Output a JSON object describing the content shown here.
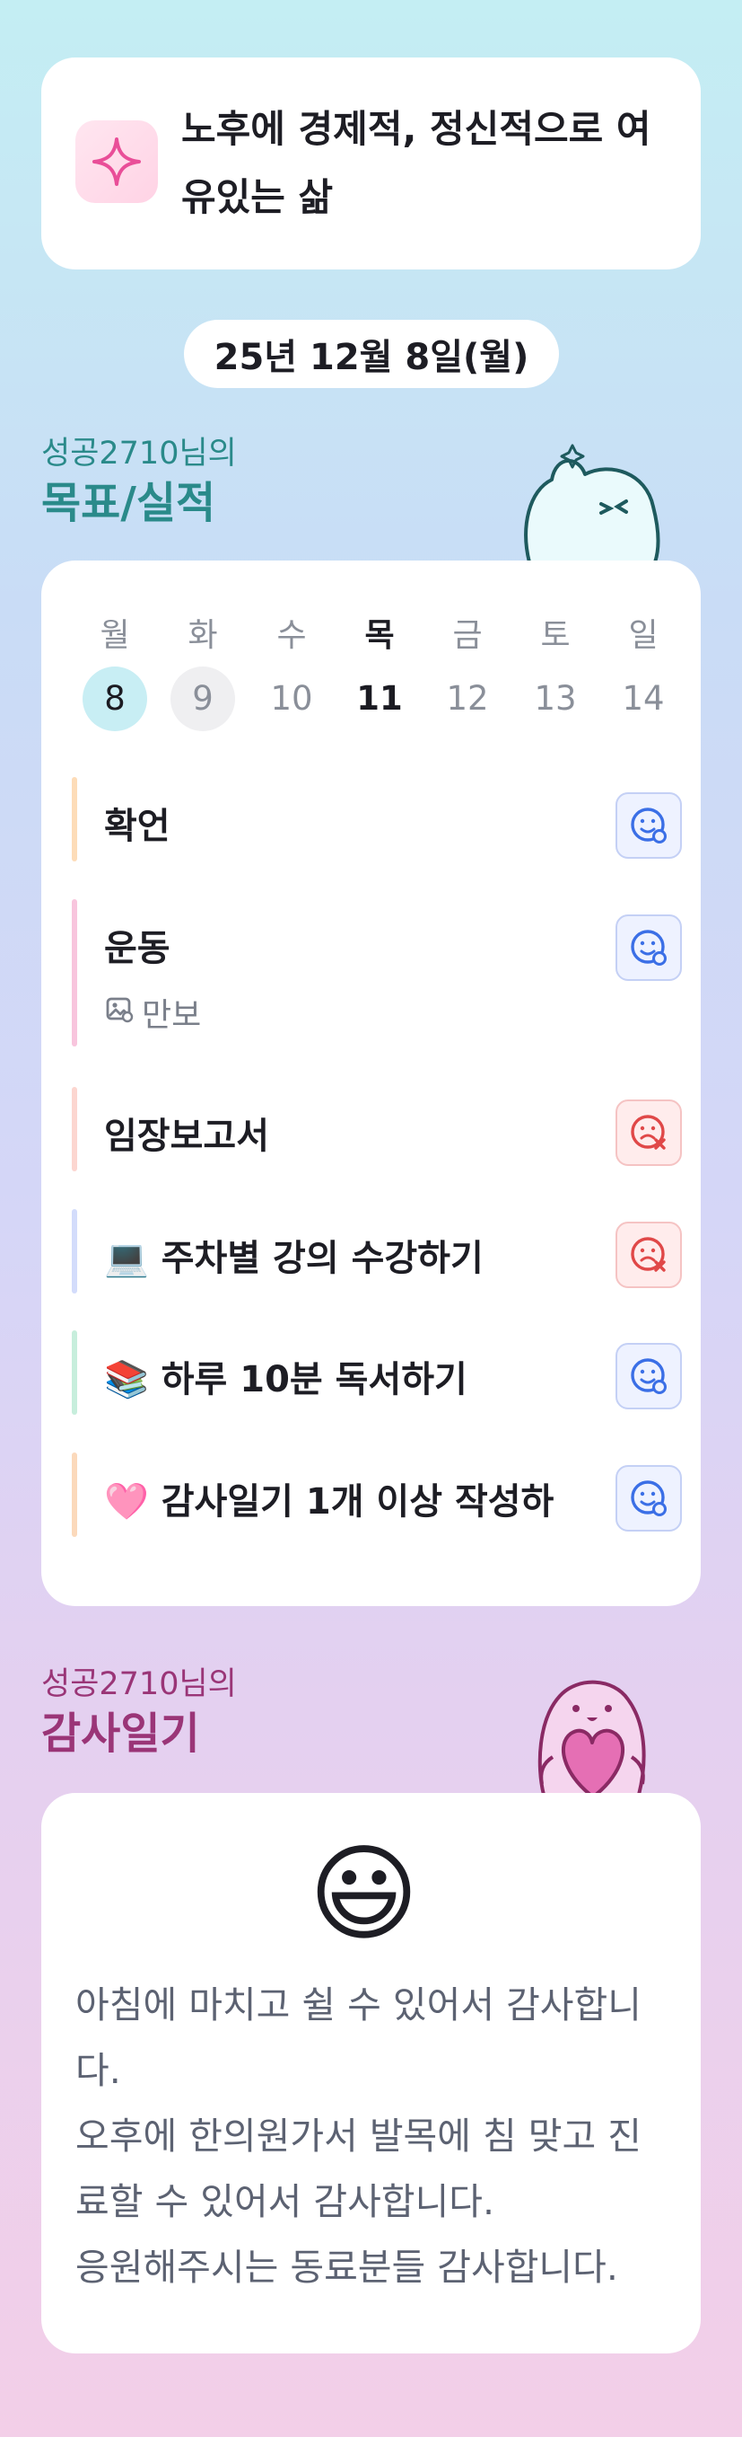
{
  "banner": {
    "text": "노후에 경제적, 정신적으로 여유있는 삶",
    "icon": "sparkle-icon",
    "accent": "#e94e98"
  },
  "date": "25년 12월 8일(월)",
  "goals_section": {
    "owner": "성공2710님의",
    "title": "목표/실적",
    "title_color": "#2a8a8a"
  },
  "week": [
    {
      "label": "월",
      "num": "8"
    },
    {
      "label": "화",
      "num": "9"
    },
    {
      "label": "수",
      "num": "10"
    },
    {
      "label": "목",
      "num": "11"
    },
    {
      "label": "금",
      "num": "12"
    },
    {
      "label": "토",
      "num": "13"
    },
    {
      "label": "일",
      "num": "14"
    }
  ],
  "goals": [
    {
      "text": "확언",
      "status": "done",
      "color": "#fddcb8"
    },
    {
      "text": "운동",
      "sub": "만보",
      "status": "done",
      "color": "#f8c5dd"
    },
    {
      "text": "임장보고서",
      "status": "missed",
      "color": "#fcd6d0"
    },
    {
      "text": "💻 주차별 강의 수강하기",
      "status": "missed",
      "color": "#d3dcfb"
    },
    {
      "text": "📚 하루 10분 독서하기",
      "status": "done",
      "color": "#c7eedc"
    },
    {
      "text": "🩷 감사일기 1개 이상 작성하",
      "status": "done",
      "color": "#fbd9bb"
    }
  ],
  "diary_section": {
    "owner": "성공2710님의",
    "title": "감사일기",
    "title_color": "#9a3577"
  },
  "diary": {
    "emoji": "😃",
    "text": "아침에 마치고 쉴 수 있어서 감사합니다.\n오후에 한의원가서 발목에 침 맞고 진료할 수 있어서 감사합니다.\n응원해주시는 동료분들 감사합니다."
  }
}
